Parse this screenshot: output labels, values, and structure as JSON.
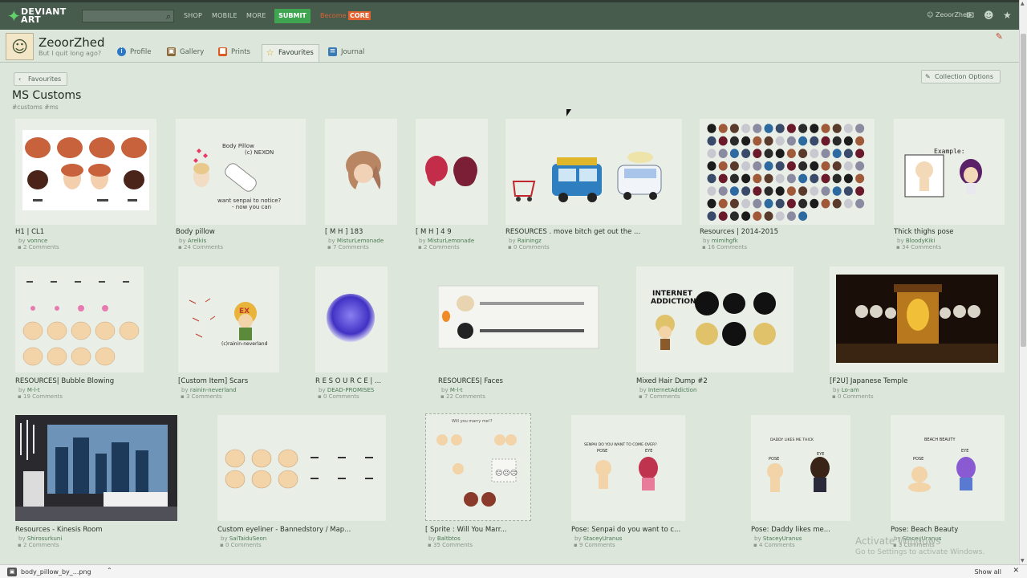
{
  "topbar": {
    "logo_line1": "DEVIANT",
    "logo_line2": "ART",
    "search_placeholder": "",
    "nav": [
      "SHOP",
      "MOBILE",
      "MORE"
    ],
    "submit_label": "SUBMIT",
    "become_label": "Become",
    "core_label": "CORE",
    "username": "ZeoorZhed"
  },
  "profile": {
    "name": "ZeoorZhed",
    "tagline": "But I quit long ago?",
    "tabs": [
      {
        "label": "Profile",
        "icon": "info-icon"
      },
      {
        "label": "Gallery",
        "icon": "gallery-icon"
      },
      {
        "label": "Prints",
        "icon": "prints-icon"
      },
      {
        "label": "Favourites",
        "icon": "star-icon",
        "active": true
      },
      {
        "label": "Journal",
        "icon": "journal-icon"
      }
    ]
  },
  "collection": {
    "back_label": "Favourites",
    "title": "MS Customs",
    "tags": "#customs #ms",
    "options_label": "Collection Options"
  },
  "cards": [
    {
      "title": "H1 | CL1",
      "by": "by",
      "author": "vonnce",
      "comments": "2 Comments"
    },
    {
      "title": "Body pillow",
      "by": "by",
      "author": "Arelkis",
      "comments": "24 Comments"
    },
    {
      "title": "[ M H ] 183",
      "by": "by",
      "author": "MisturLemonade",
      "comments": "7 Comments"
    },
    {
      "title": "[ M H ] 4 9",
      "by": "by",
      "author": "MisturLemonade",
      "comments": "2 Comments"
    },
    {
      "title": "RESOURCES . move bitch get out the ...",
      "by": "by",
      "author": "Rainingz",
      "comments": "0 Comments"
    },
    {
      "title": "Resources | 2014-2015",
      "by": "by",
      "author": "mimihgfk",
      "comments": "16 Comments"
    },
    {
      "title": "Thick thighs pose",
      "by": "by",
      "author": "BloodyKiki",
      "comments": "34 Comments"
    },
    {
      "title": "RESOURCES| Bubble Blowing",
      "by": "by",
      "author": "M-l-t",
      "comments": "19 Comments"
    },
    {
      "title": "[Custom Item] Scars",
      "by": "by",
      "author": "rainin-neverland",
      "comments": "3 Comments"
    },
    {
      "title": "R E S O U R C E | ...",
      "by": "by",
      "author": "DEAD-PROMISES",
      "comments": "0 Comments"
    },
    {
      "title": "RESOURCES| Faces",
      "by": "by",
      "author": "M-l-t",
      "comments": "22 Comments"
    },
    {
      "title": "Mixed Hair Dump #2",
      "by": "by",
      "author": "InternetAddiction",
      "comments": "7 Comments"
    },
    {
      "title": "[F2U] Japanese Temple",
      "by": "by",
      "author": "Lo-am",
      "comments": "0 Comments"
    },
    {
      "title": "Resources - Kinesis Room",
      "by": "by",
      "author": "Shirosurkuni",
      "comments": "2 Comments"
    },
    {
      "title": "Custom eyeliner - Bannedstory / Map...",
      "by": "by",
      "author": "SaiTaiduSeon",
      "comments": "0 Comments"
    },
    {
      "title": "[ Sprite : Will You Marr...",
      "by": "by",
      "author": "Baltbtos",
      "comments": "35 Comments"
    },
    {
      "title": "Pose: Senpai do you want to c...",
      "by": "by",
      "author": "StaceyUranus",
      "comments": "9 Comments"
    },
    {
      "title": "Pose: Daddy likes me...",
      "by": "by",
      "author": "StaceyUranus",
      "comments": "4 Comments"
    },
    {
      "title": "Pose: Beach Beauty",
      "by": "by",
      "author": "StaceyUranus",
      "comments": "3 Comments"
    }
  ],
  "thumb_text": {
    "pillow_line1": "Body Pillow",
    "pillow_line2": "(c) NEXON",
    "pillow_line3": "want senpai to notice?",
    "pillow_line4": "- now you can",
    "thick_example": "Example:",
    "scars_credit": "(c)rainin-neverland",
    "internet_line1": "INTERNET",
    "internet_line2": "ADDICTION",
    "marry": "Will you marry me!?",
    "senpai_caption": "SENPAI DO YOU WANT TO COME OVER?",
    "daddy_caption": "DADDY LIKES ME THICK",
    "beach_caption": "BEACH BEAUTY",
    "pose_label": "POSE",
    "eye_label": "EYE"
  },
  "downloads": {
    "file": "body_pillow_by_...png",
    "show_all": "Show all"
  },
  "watermark": {
    "line1": "Activate Windows",
    "line2": "Go to Settings to activate Windows."
  },
  "colors": {
    "topbar": "#475c4d",
    "page_bg": "#dde6da",
    "submit": "#3fa551",
    "core": "#e2622f"
  }
}
